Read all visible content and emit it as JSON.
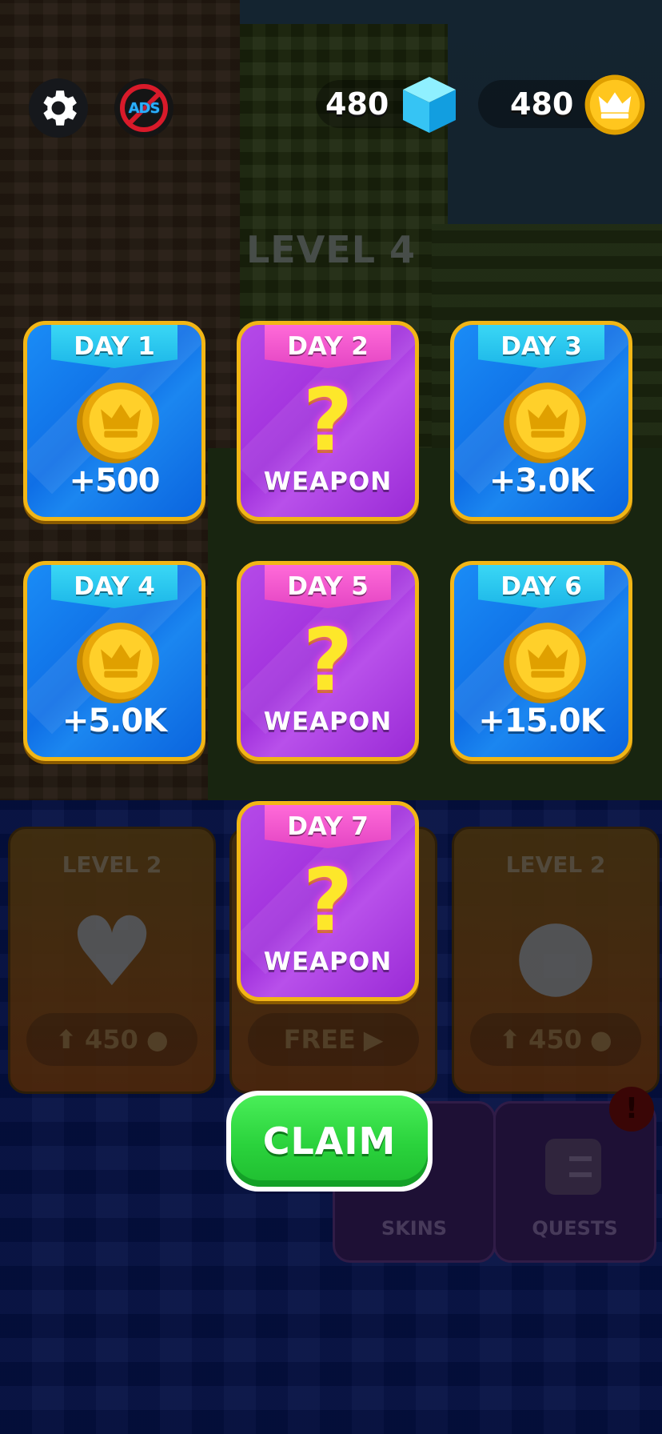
{
  "background": {
    "level_title": "LEVEL 4",
    "upgrades": [
      {
        "level": "LEVEL 2",
        "price": "450",
        "icon": "heart-icon"
      },
      {
        "action": "FREE",
        "icon": "video-icon"
      },
      {
        "level": "LEVEL 2",
        "price": "450",
        "icon": "coin-stack-icon"
      }
    ],
    "tiles": {
      "skins": "SKINS",
      "quests": "QUESTS"
    },
    "alert": "!"
  },
  "hud": {
    "settings_icon": "gear-icon",
    "no_ads_icon": "no-ads-icon",
    "no_ads_text": "ADS",
    "gems": "480",
    "coins": "480"
  },
  "rewards": [
    {
      "day": "DAY 1",
      "type": "coin",
      "label": "+500"
    },
    {
      "day": "DAY 2",
      "type": "mystery",
      "symbol": "?",
      "label": "WEAPON"
    },
    {
      "day": "DAY 3",
      "type": "coin",
      "label": "+3.0K"
    },
    {
      "day": "DAY 4",
      "type": "coin",
      "label": "+5.0K"
    },
    {
      "day": "DAY 5",
      "type": "mystery",
      "symbol": "?",
      "label": "WEAPON"
    },
    {
      "day": "DAY 6",
      "type": "coin",
      "label": "+15.0K"
    },
    {
      "day": "DAY 7",
      "type": "mystery",
      "symbol": "?",
      "label": "WEAPON"
    }
  ],
  "claim_label": "CLAIM",
  "colors": {
    "coin_card": "#1478ee",
    "mystery_card": "#a835e0",
    "card_border": "#f2b616",
    "claim_green": "#2ad23c"
  }
}
